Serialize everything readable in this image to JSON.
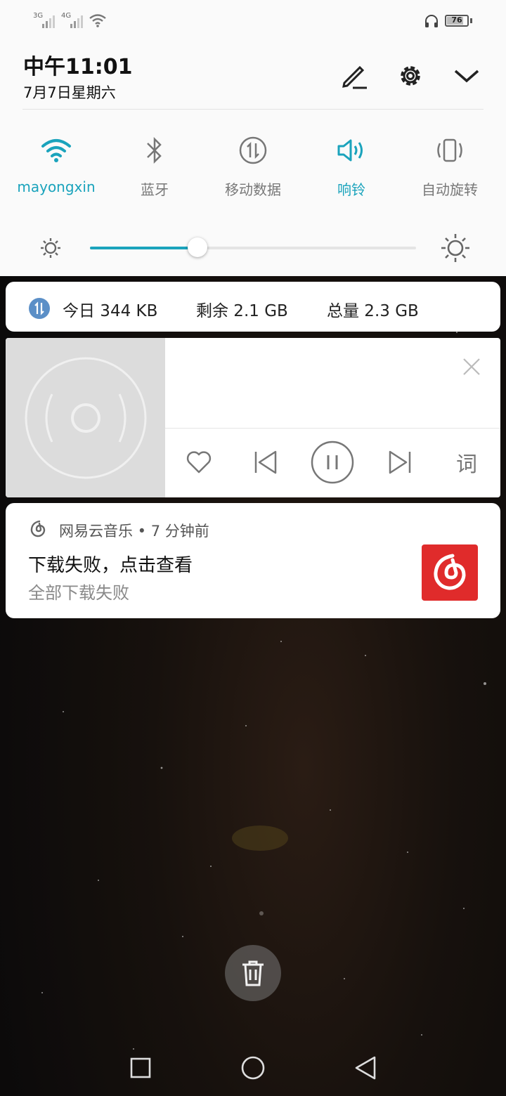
{
  "status_bar": {
    "sim1_label": "3G",
    "sim2_label": "4G",
    "battery": "76",
    "icons": [
      "signal-icon",
      "signal-icon",
      "wifi-icon",
      "headphones-icon",
      "battery-icon"
    ]
  },
  "header": {
    "time": "中午11:01",
    "date": "7月7日星期六",
    "buttons": [
      "edit-icon",
      "settings-icon",
      "collapse-chevron-icon"
    ]
  },
  "quick_settings": [
    {
      "label": "mayongxin",
      "icon": "wifi-icon",
      "active": true
    },
    {
      "label": "蓝牙",
      "icon": "bluetooth-icon",
      "active": false
    },
    {
      "label": "移动数据",
      "icon": "mobile-data-icon",
      "active": false
    },
    {
      "label": "响铃",
      "icon": "ring-icon",
      "active": true
    },
    {
      "label": "自动旋转",
      "icon": "auto-rotate-icon",
      "active": false
    }
  ],
  "brightness": {
    "level": 0.33
  },
  "data_usage": {
    "today": "今日 344 KB",
    "remaining": "剩余 2.1 GB",
    "total": "总量 2.3 GB"
  },
  "music": {
    "controls": [
      "heart-icon",
      "previous-icon",
      "pause-icon",
      "next-icon"
    ],
    "lyrics_label": "词"
  },
  "notification": {
    "app_line": "网易云音乐 • 7 分钟前",
    "title": "下载失败，点击查看",
    "text": "全部下载失败"
  },
  "colors": {
    "accent": "#1aa3bc",
    "netease_red": "#e02b2b"
  },
  "nav_bar": [
    "recents-icon",
    "home-icon",
    "back-icon"
  ]
}
